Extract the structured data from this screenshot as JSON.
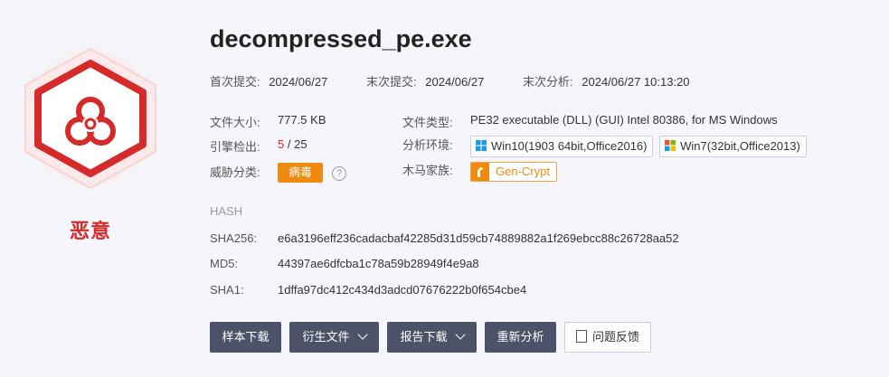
{
  "file": {
    "name": "decompressed_pe.exe",
    "verdict": "恶意"
  },
  "dates": {
    "first_submit_label": "首次提交:",
    "first_submit": "2024/06/27",
    "last_submit_label": "末次提交:",
    "last_submit": "2024/06/27",
    "last_analysis_label": "末次分析:",
    "last_analysis": "2024/06/27 10:13:20"
  },
  "info": {
    "size_label": "文件大小:",
    "size": "777.5 KB",
    "engines_label": "引擎检出:",
    "detected": "5",
    "total": "/ 25",
    "threat_label": "威胁分类:",
    "threat": "病毒",
    "help": "?",
    "type_label": "文件类型:",
    "type": "PE32 executable (DLL) (GUI) Intel 80386, for MS Windows",
    "env_label": "分析环境:",
    "env": [
      "Win10(1903 64bit,Office2016)",
      "Win7(32bit,Office2013)"
    ],
    "family_label": "木马家族:",
    "family": "Gen-Crypt"
  },
  "hash": {
    "title": "HASH",
    "sha256_label": "SHA256:",
    "sha256": "e6a3196eff236cadacbaf42285d31d59cb74889882a1f269ebcc88c26728aa52",
    "md5_label": "MD5:",
    "md5": "44397ae6dfcba1c78a59b28949f4e9a8",
    "sha1_label": "SHA1:",
    "sha1": "1dffa97dc412c434d3adcd07676222b0f654cbe4"
  },
  "actions": {
    "download_sample": "样本下载",
    "derived_files": "衍生文件",
    "report_download": "报告下载",
    "reanalyze": "重新分析",
    "feedback": "问题反馈"
  },
  "colors": {
    "malicious": "#d42a2a",
    "virus_tag": "#f0890f",
    "button": "#4c5368"
  }
}
